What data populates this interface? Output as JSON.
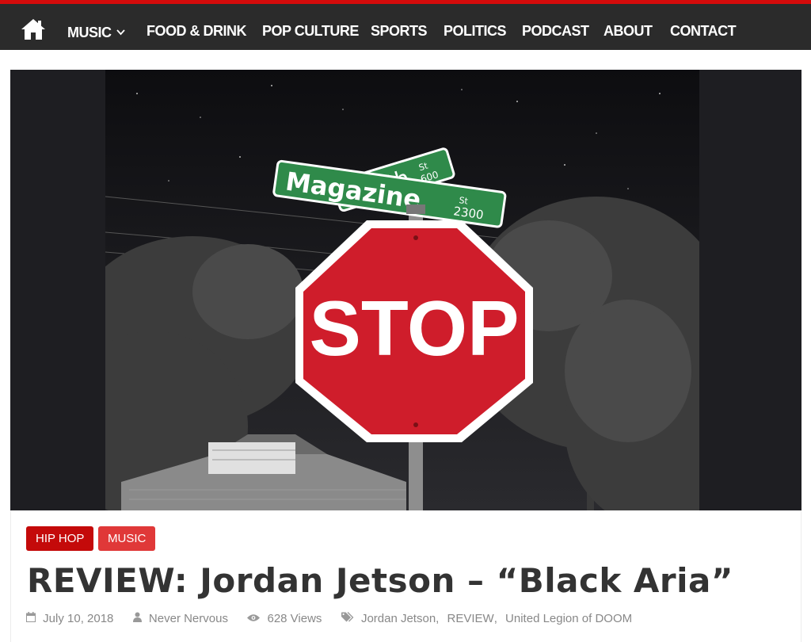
{
  "nav": {
    "items": [
      {
        "label": "MUSIC",
        "has_dropdown": true
      },
      {
        "label": "FOOD & DRINK"
      },
      {
        "label": "POP CULTURE"
      },
      {
        "label": "SPORTS"
      },
      {
        "label": "POLITICS"
      },
      {
        "label": "PODCAST"
      },
      {
        "label": "ABOUT"
      },
      {
        "label": "CONTACT"
      }
    ]
  },
  "hero": {
    "sign_street_1": "Magazine",
    "sign_street_1_sub": "St",
    "sign_street_1_num": "2300",
    "sign_street_2": "24th",
    "sign_street_2_sub": "St",
    "sign_street_2_num": "600",
    "stop_text": "STOP"
  },
  "post": {
    "categories": [
      "HIP HOP",
      "MUSIC"
    ],
    "title": "REVIEW: Jordan Jetson – “Black Aria”",
    "date": "July 10, 2018",
    "author": "Never Nervous",
    "views": "628 Views",
    "tags": [
      "Jordan Jetson",
      "REVIEW",
      "United Legion of DOOM"
    ]
  },
  "colors": {
    "accent": "#d40b0b",
    "nav_bg": "#2b2b2b",
    "category_hiphop": "#c40a0a",
    "category_music": "#e03838"
  }
}
